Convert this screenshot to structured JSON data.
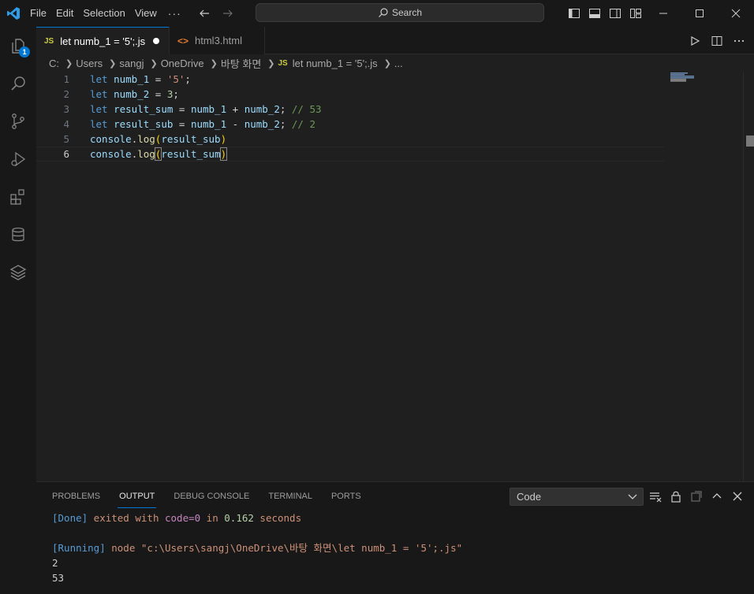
{
  "menu": {
    "file": "File",
    "edit": "Edit",
    "selection": "Selection",
    "view": "View",
    "more": "···"
  },
  "search": {
    "label": "Search"
  },
  "activity": {
    "explorer_badge": "1"
  },
  "tabs": [
    {
      "label": "let numb_1 = '5';.js",
      "badge": "JS"
    },
    {
      "label": "html3.html",
      "badge": "<>"
    }
  ],
  "breadcrumb": [
    "C:",
    "Users",
    "sangj",
    "OneDrive",
    "바탕 화면",
    "let numb_1 = '5';.js",
    "..."
  ],
  "breadcrumb_file_badge": "JS",
  "editor": {
    "line_numbers": [
      "1",
      "2",
      "3",
      "4",
      "5",
      "6"
    ],
    "lines": [
      {
        "kw": "let",
        "name": "numb_1",
        "eq": " = ",
        "val": "'5'",
        "end": ";"
      },
      {
        "kw": "let",
        "name": "numb_2",
        "eq": " = ",
        "val": "3",
        "end": ";"
      },
      {
        "kw": "let",
        "name": "result_sum",
        "eq": " = ",
        "a": "numb_1",
        "op": " + ",
        "b": "numb_2",
        "end": "; ",
        "comment": "// 53"
      },
      {
        "kw": "let",
        "name": "result_sub",
        "eq": " = ",
        "a": "numb_1",
        "op": " - ",
        "b": "numb_2",
        "end": "; ",
        "comment": "// 2"
      },
      {
        "obj": "console",
        "dot": ".",
        "fn": "log",
        "open": "(",
        "arg": "result_sub",
        "close": ")"
      },
      {
        "obj": "console",
        "dot": ".",
        "fn": "log",
        "open": "(",
        "arg": "result_sum",
        "close": ")"
      }
    ]
  },
  "panel": {
    "tabs": [
      "PROBLEMS",
      "OUTPUT",
      "DEBUG CONSOLE",
      "TERMINAL",
      "PORTS"
    ],
    "channel": "Code",
    "output": {
      "done_tag": "[Done]",
      "done_text": " exited with ",
      "done_code": "code=0",
      "done_in": " in ",
      "done_time": "0.162",
      "done_unit": " seconds",
      "running_tag": "[Running]",
      "running_cmd": " node \"c:\\Users\\sangj\\OneDrive\\바탕 화면\\let numb_1 = '5';.js\"",
      "result1": "2",
      "result2": "53"
    }
  }
}
